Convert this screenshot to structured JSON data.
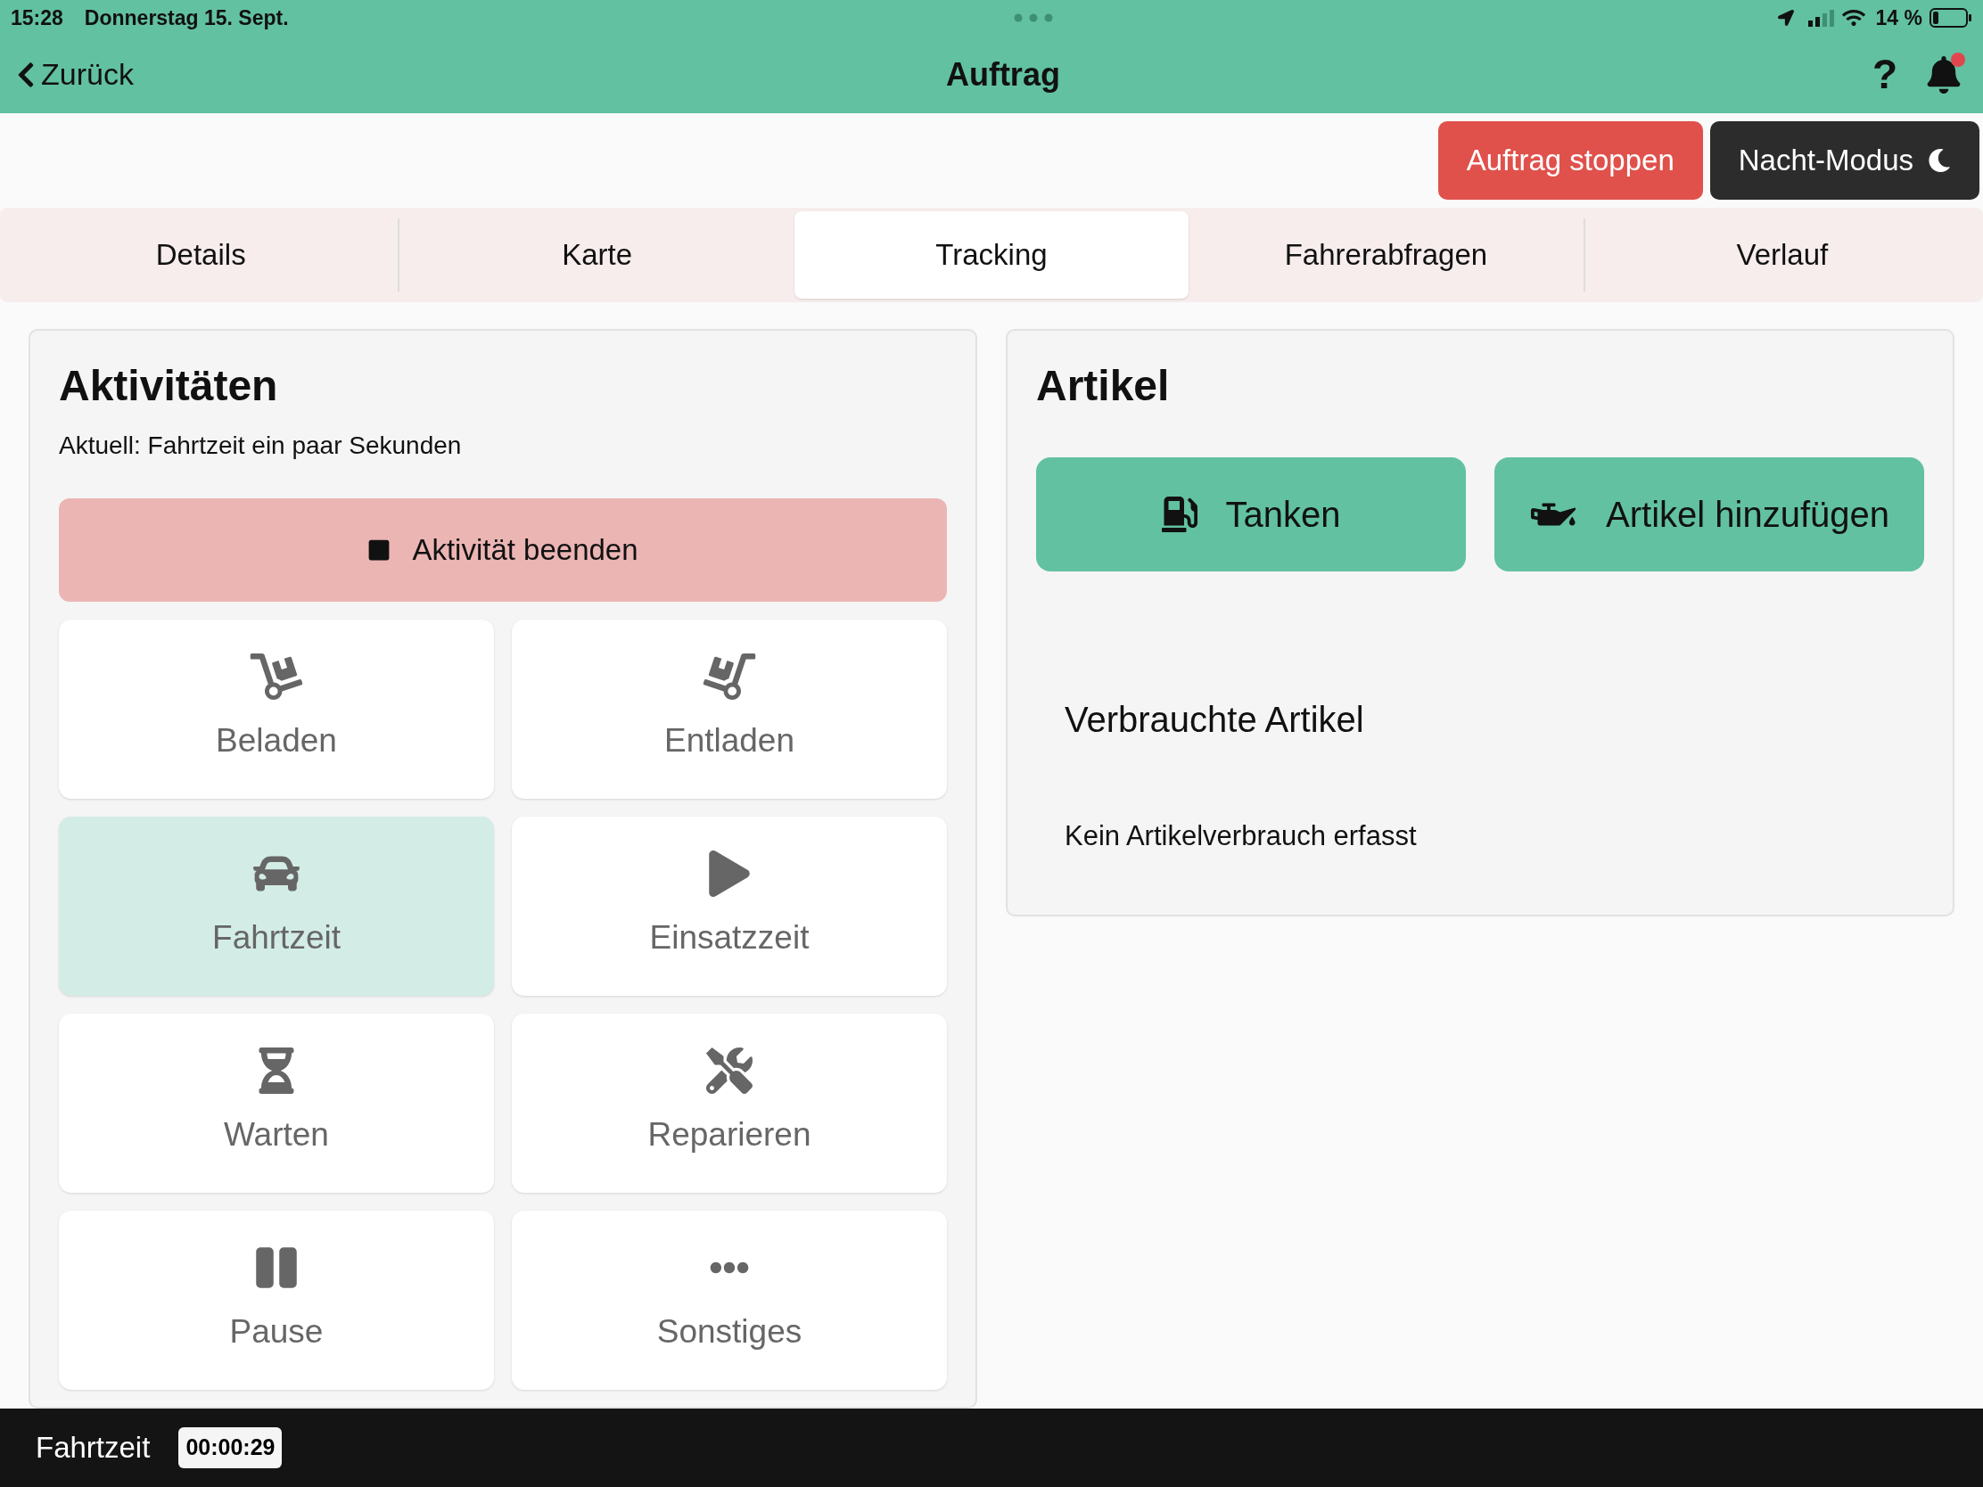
{
  "status_bar": {
    "time": "15:28",
    "date": "Donnerstag 15. Sept.",
    "battery": "14 %"
  },
  "header": {
    "back": "Zurück",
    "title": "Auftrag",
    "help": "?",
    "notification_dot": true
  },
  "actions": {
    "stop": "Auftrag stoppen",
    "night_mode": "Nacht-Modus"
  },
  "tabs": [
    {
      "label": "Details",
      "selected": false
    },
    {
      "label": "Karte",
      "selected": false
    },
    {
      "label": "Tracking",
      "selected": true
    },
    {
      "label": "Fahrerabfragen",
      "selected": false
    },
    {
      "label": "Verlauf",
      "selected": false
    }
  ],
  "activities": {
    "title": "Aktivitäten",
    "current": "Aktuell: Fahrtzeit ein paar Sekunden",
    "end_button": "Aktivität beenden",
    "items": [
      {
        "label": "Beladen",
        "selected": false
      },
      {
        "label": "Entladen",
        "selected": false
      },
      {
        "label": "Fahrtzeit",
        "selected": true
      },
      {
        "label": "Einsatzzeit",
        "selected": false
      },
      {
        "label": "Warten",
        "selected": false
      },
      {
        "label": "Reparieren",
        "selected": false
      },
      {
        "label": "Pause",
        "selected": false
      },
      {
        "label": "Sonstiges",
        "selected": false
      }
    ]
  },
  "articles": {
    "title": "Artikel",
    "buttons": [
      "Tanken",
      "Artikel hinzufügen"
    ],
    "used_title": "Verbrauchte Artikel",
    "empty": "Kein Artikelverbrauch erfasst"
  },
  "bottom_bar": {
    "activity": "Fahrtzeit",
    "timer": "00:00:29"
  }
}
